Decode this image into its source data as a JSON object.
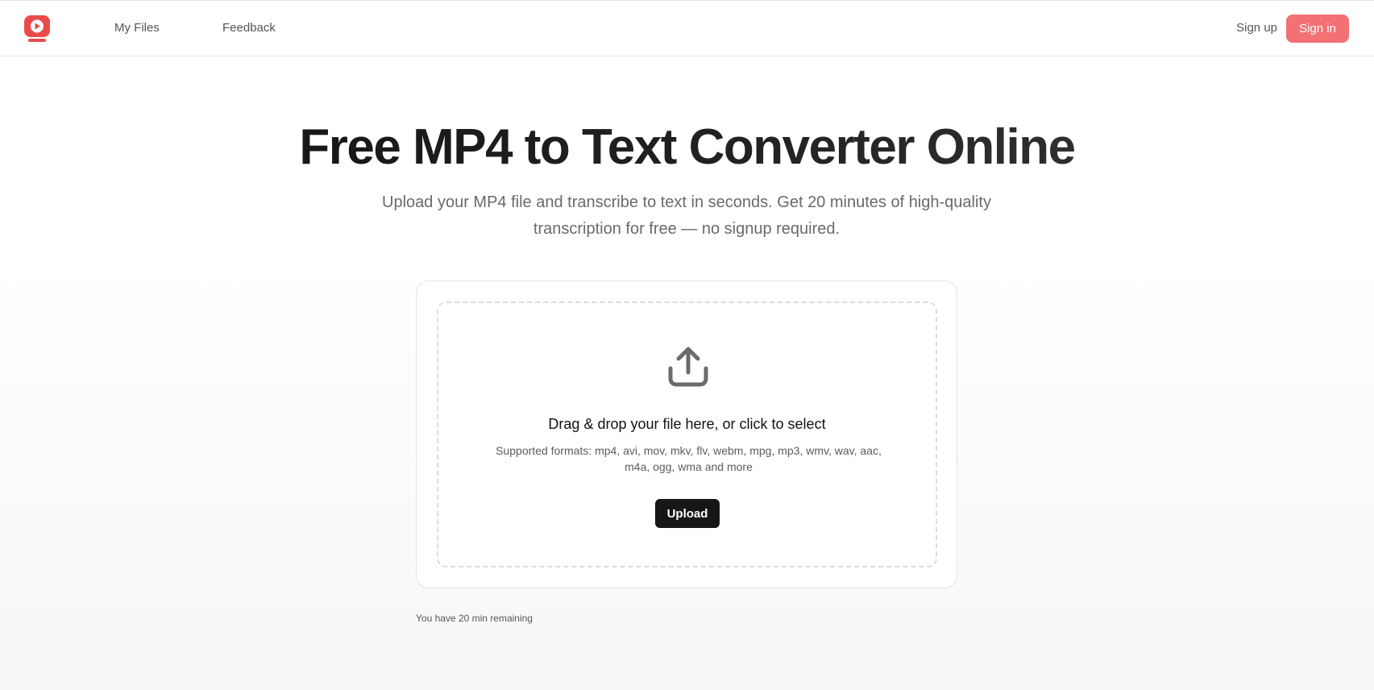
{
  "header": {
    "logo_name": "play-logo-icon",
    "nav": [
      {
        "label": "My Files"
      },
      {
        "label": "Feedback"
      }
    ],
    "signup_label": "Sign up",
    "signin_label": "Sign in"
  },
  "hero": {
    "title": "Free MP4 to Text Converter Online",
    "subtitle": "Upload your MP4 file and transcribe to text in seconds. Get 20 minutes of high-quality transcription for free — no signup required."
  },
  "upload": {
    "icon": "upload-icon",
    "title": "Drag & drop your file here, or click to select",
    "formats": "Supported formats: mp4, avi, mov, mkv, flv, webm, mpg, mp3, wmv, wav, aac, m4a, ogg, wma and more",
    "button_label": "Upload"
  },
  "footer_note": {
    "remaining": "You have 20 min remaining"
  },
  "colors": {
    "accent": "#f47173",
    "logo_red": "#e94b4b",
    "button_dark": "#161616"
  }
}
